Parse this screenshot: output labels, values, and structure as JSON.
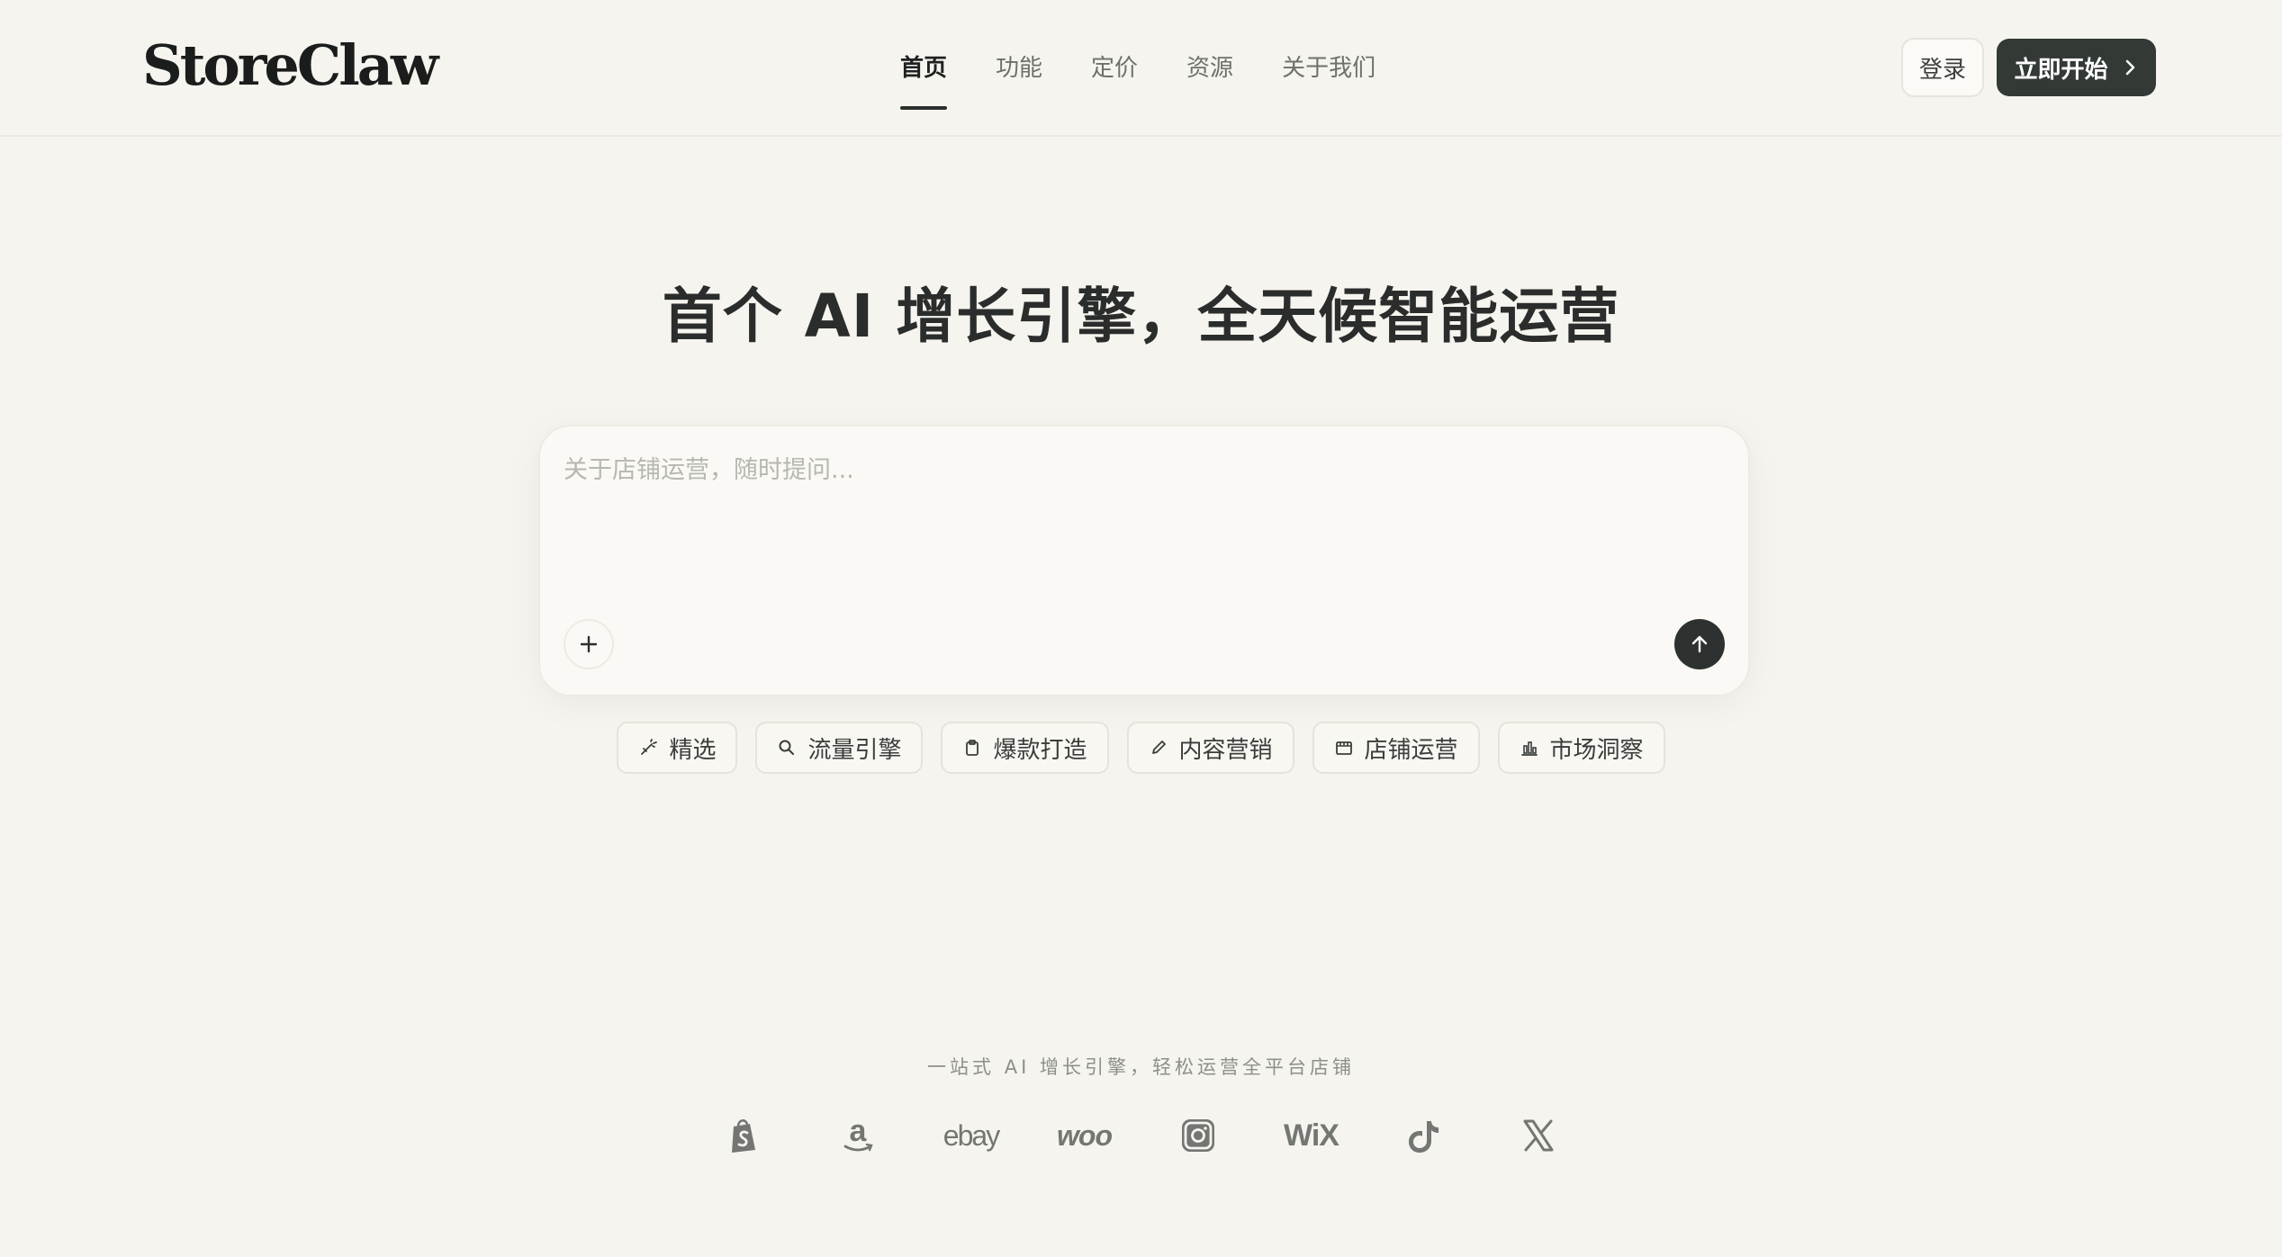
{
  "header": {
    "logo": "StoreClaw",
    "nav": [
      {
        "label": "首页",
        "active": true
      },
      {
        "label": "功能",
        "active": false
      },
      {
        "label": "定价",
        "active": false
      },
      {
        "label": "资源",
        "active": false
      },
      {
        "label": "关于我们",
        "active": false
      }
    ],
    "login_label": "登录",
    "start_label": "立即开始"
  },
  "hero": {
    "title": "首个 AI 增长引擎，全天候智能运营",
    "placeholder": "关于店铺运营，随时提问..."
  },
  "chips": [
    {
      "label": "精选",
      "icon": "sparkle-pen-icon"
    },
    {
      "label": "流量引擎",
      "icon": "search-icon"
    },
    {
      "label": "爆款打造",
      "icon": "clipboard-icon"
    },
    {
      "label": "内容营销",
      "icon": "pencil-icon"
    },
    {
      "label": "店铺运营",
      "icon": "store-icon"
    },
    {
      "label": "市场洞察",
      "icon": "bar-chart-icon"
    }
  ],
  "footer": {
    "tagline": "一站式 AI 增长引擎，轻松运营全平台店铺",
    "platforms": [
      {
        "name": "shopify-icon"
      },
      {
        "name": "amazon-icon"
      },
      {
        "name": "ebay-icon",
        "text": "ebay"
      },
      {
        "name": "woo-icon",
        "text": "woo"
      },
      {
        "name": "instagram-icon"
      },
      {
        "name": "wix-icon",
        "text": "WiX"
      },
      {
        "name": "tiktok-icon"
      },
      {
        "name": "x-icon"
      }
    ]
  },
  "colors": {
    "background": "#f5f4ee",
    "primary_button": "#333a36",
    "text": "#2c2f2d"
  }
}
